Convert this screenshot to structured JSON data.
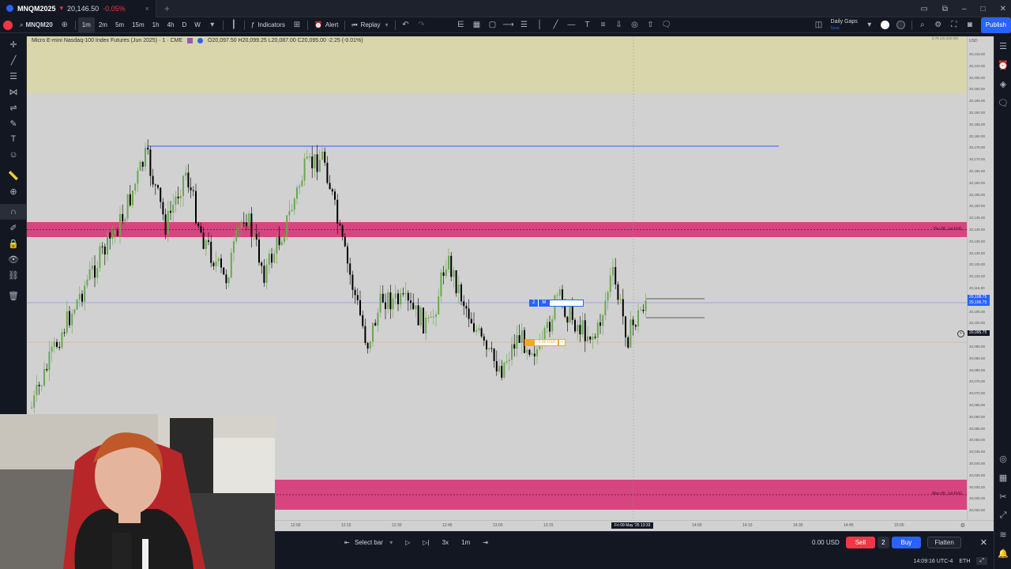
{
  "browser": {
    "tab_symbol": "MNQM2025",
    "tab_price": "20,146.50",
    "tab_change": "-0.05%"
  },
  "toolbar": {
    "symbol": "MNQM20",
    "intervals": [
      "1m",
      "2m",
      "5m",
      "15m",
      "1h",
      "4h",
      "D",
      "W"
    ],
    "active_interval": "1m",
    "indicators_label": "Indicators",
    "alert_label": "Alert",
    "replay_label": "Replay",
    "layout_name": "Daily Gaps",
    "layout_sub": "Save",
    "publish_label": "Publish"
  },
  "legend": {
    "title": "Micro E-mini Nasdaq-100 Index Futures (Jun 2025) · 1 · CME",
    "ohlc": "O20,097.50 H20,099.25 L20,087.00 C20,095.00 -2.25 (-0.01%)"
  },
  "price_scale": {
    "currency": "USD",
    "ticks": [
      "20,215.00",
      "20,210.00",
      "20,205.00",
      "20,200.00",
      "20,195.00",
      "20,190.00",
      "20,185.00",
      "20,180.00",
      "20,175.00",
      "20,170.00",
      "20,165.00",
      "20,160.00",
      "20,155.00",
      "20,150.00",
      "20,145.00",
      "20,140.00",
      "20,135.00",
      "20,130.00",
      "20,125.00",
      "20,120.00",
      "20,115.00",
      "20,110.00",
      "20,105.00",
      "20,100.00",
      "20,095.00",
      "20,090.00",
      "20,085.00",
      "20,080.00",
      "20,075.00",
      "20,070.00",
      "20,065.00",
      "20,060.00",
      "20,055.00",
      "20,050.00",
      "20,045.00",
      "20,040.00",
      "20,035.00",
      "20,030.00",
      "20,025.00",
      "20,020.00"
    ],
    "blue_badge_1": "20,108.75",
    "blue_badge_2": "20,106.75",
    "dark_badge": "20,095.75",
    "top_label": "0.75 (20,222.00)"
  },
  "zones": {
    "upper_label": "Thu 08, 1st FVG",
    "lower_label": "Mon 05, 1st FVG"
  },
  "orders": {
    "limit_qty": "2",
    "limit_side": "M",
    "stop_value": "-0.00 USD"
  },
  "time_axis": {
    "ticks": [
      "12:00",
      "12:15",
      "12:30",
      "12:45",
      "13:00",
      "13:15",
      "13:45",
      "14:00",
      "14:15",
      "14:30",
      "14:45",
      "15:00"
    ],
    "crosshair_label": "Fri 09 May '25  13:33"
  },
  "trading": {
    "select_bar": "Select bar",
    "speed": "3x",
    "interval": "1m",
    "pnl": "0.00 USD",
    "sell_label": "Sell",
    "qty": "2",
    "buy_label": "Buy",
    "flatten_label": "Flatten"
  },
  "status": {
    "clock": "14:09:16 UTC-4",
    "session": "ETH"
  },
  "colors": {
    "fvg_zone": "#d6457f",
    "premium_zone": "#d8d6aa",
    "chart_bg": "#d1d1d1",
    "up_candle": "#6aa84f",
    "down_candle": "#000000",
    "resistance_line": "#2962ff"
  }
}
